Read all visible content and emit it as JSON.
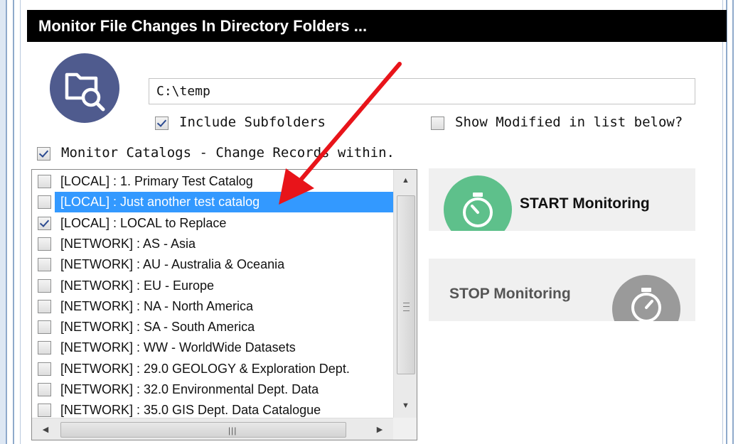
{
  "title": "Monitor File Changes In Directory Folders ...",
  "folder_path": "C:\\temp",
  "options": {
    "include_subfolders": {
      "label": "Include Subfolders",
      "checked": true
    },
    "show_modified": {
      "label": "Show Modified in list below?",
      "checked": false
    },
    "monitor_catalogs": {
      "label": "Monitor Catalogs - Change Records within.",
      "checked": true
    }
  },
  "catalogs": [
    {
      "label": "[LOCAL] : 1. Primary Test Catalog",
      "checked": false,
      "selected": false
    },
    {
      "label": "[LOCAL] : Just another test catalog",
      "checked": false,
      "selected": true
    },
    {
      "label": "[LOCAL] : LOCAL to Replace",
      "checked": true,
      "selected": false
    },
    {
      "label": "[NETWORK] : AS - Asia",
      "checked": false,
      "selected": false
    },
    {
      "label": "[NETWORK] : AU - Australia & Oceania",
      "checked": false,
      "selected": false
    },
    {
      "label": "[NETWORK] : EU - Europe",
      "checked": false,
      "selected": false
    },
    {
      "label": "[NETWORK] : NA - North America",
      "checked": false,
      "selected": false
    },
    {
      "label": "[NETWORK] : SA - South America",
      "checked": false,
      "selected": false
    },
    {
      "label": "[NETWORK] : WW - WorldWide Datasets",
      "checked": false,
      "selected": false
    },
    {
      "label": "[NETWORK] : 29.0 GEOLOGY & Exploration Dept.",
      "checked": false,
      "selected": false
    },
    {
      "label": "[NETWORK] : 32.0 Environmental Dept. Data",
      "checked": false,
      "selected": false
    },
    {
      "label": "[NETWORK] : 35.0 GIS Dept. Data Catalogue",
      "checked": false,
      "selected": false
    }
  ],
  "buttons": {
    "start": "START  Monitoring",
    "stop": "STOP  Monitoring"
  },
  "icons": {
    "app": "folder-search-icon",
    "start": "stopwatch-icon",
    "stop": "stopwatch-icon",
    "annotation": "red-arrow"
  },
  "colors": {
    "title_bg": "#000000",
    "app_icon_bg": "#4f5b8e",
    "start_icon": "#5ec08b",
    "stop_icon": "#9a9a9a",
    "selection": "#3399ff",
    "arrow": "#e8141a"
  }
}
